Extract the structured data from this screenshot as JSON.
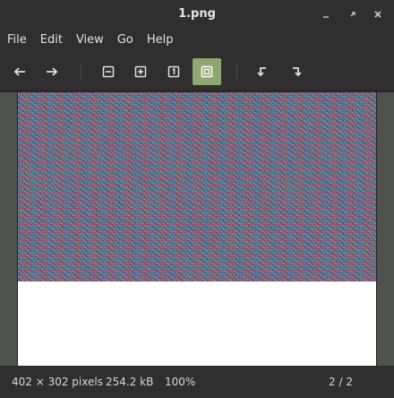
{
  "window": {
    "title": "1.png",
    "minimize_icon": "minimize-icon",
    "restore_icon": "restore-icon",
    "close_icon": "close-icon"
  },
  "menu": {
    "items": [
      "File",
      "Edit",
      "View",
      "Go",
      "Help"
    ]
  },
  "toolbar": {
    "buttons": [
      {
        "icon": "arrow-left-icon",
        "name": "previous-image-button"
      },
      {
        "icon": "arrow-right-icon",
        "name": "next-image-button"
      },
      {
        "icon": "zoom-out-icon",
        "name": "zoom-out-button"
      },
      {
        "icon": "zoom-in-icon",
        "name": "zoom-in-button"
      },
      {
        "icon": "zoom-original-icon",
        "name": "zoom-original-button"
      },
      {
        "icon": "best-fit-icon",
        "name": "best-fit-button",
        "active": true
      },
      {
        "icon": "rotate-left-icon",
        "name": "rotate-left-button"
      },
      {
        "icon": "rotate-right-icon",
        "name": "rotate-right-button"
      }
    ],
    "active_color": "#8fa872"
  },
  "status": {
    "dimensions": "402 × 302 pixels",
    "file_size": "254.2 kB",
    "zoom": "100%",
    "page": "2 / 2"
  }
}
